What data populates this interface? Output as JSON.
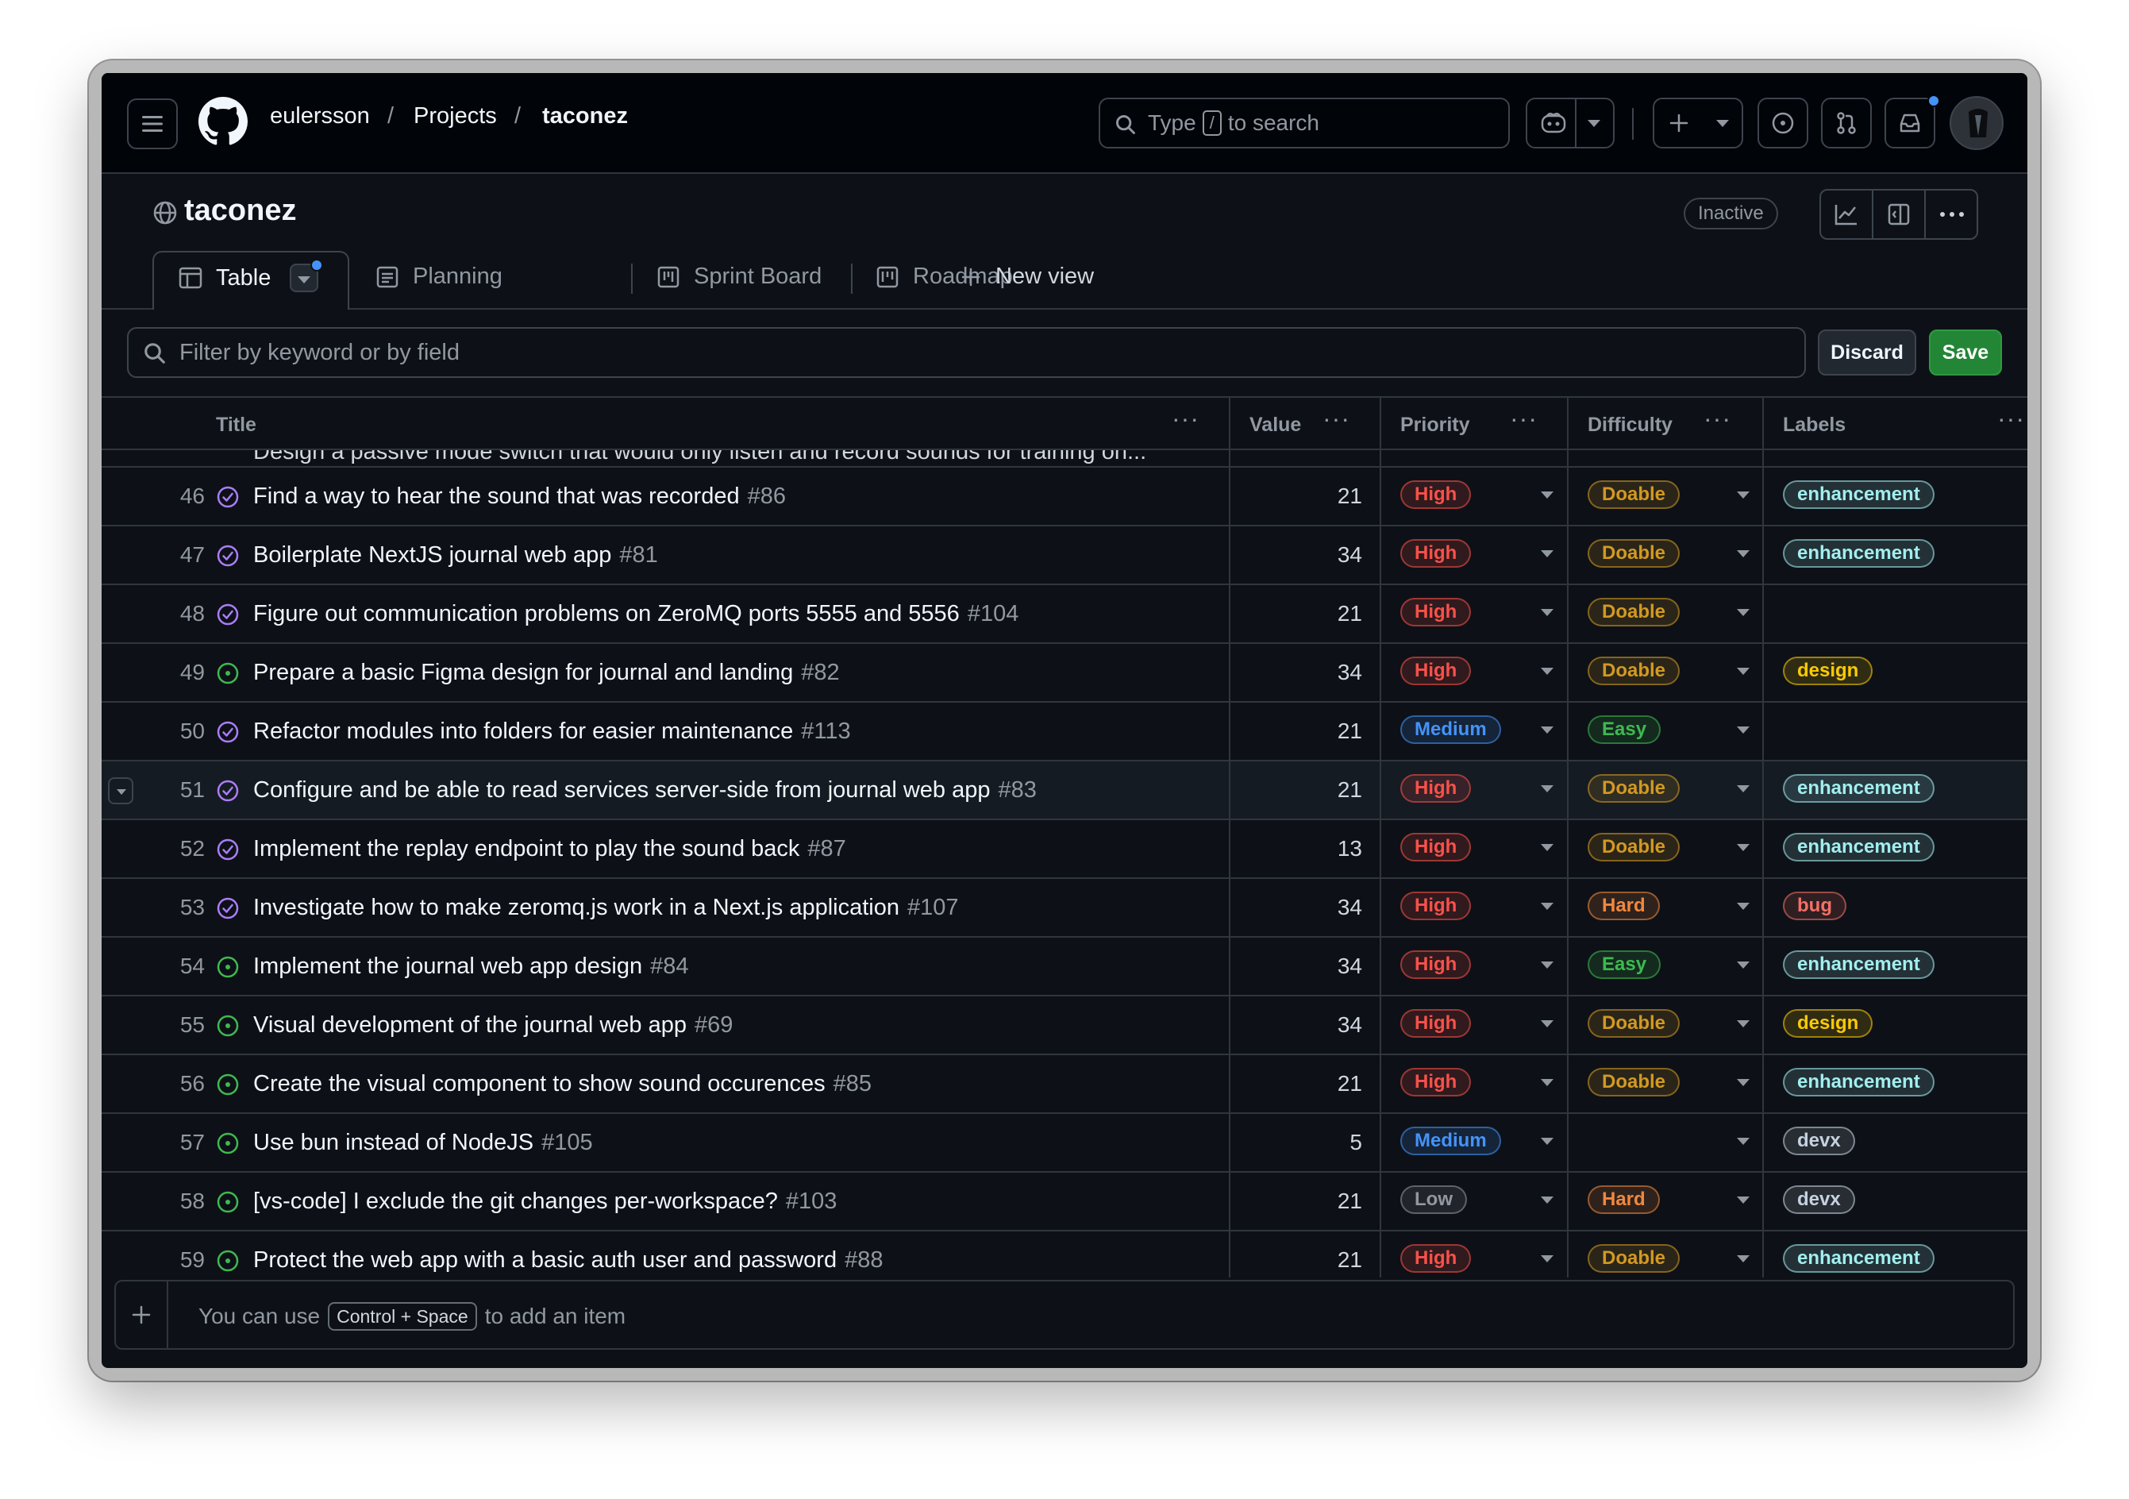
{
  "header": {
    "owner": "eulersson",
    "projects": "Projects",
    "repo": "taconez",
    "search_prefix": "Type",
    "search_key": "/",
    "search_suffix": "to search"
  },
  "project": {
    "title": "taconez",
    "status": "Inactive"
  },
  "tabs": [
    {
      "label": "Table"
    },
    {
      "label": "Planning"
    },
    {
      "label": "Sprint Board"
    },
    {
      "label": "Roadmap"
    },
    {
      "label": "New view"
    }
  ],
  "filter": {
    "placeholder": "Filter by keyword or by field",
    "discard_label": "Discard",
    "save_label": "Save"
  },
  "columns": {
    "title": "Title",
    "value": "Value",
    "priority": "Priority",
    "difficulty": "Difficulty",
    "labels": "Labels"
  },
  "partial_row": {
    "title": "Design a passive mode switch that would only listen and record sounds for training on..."
  },
  "rows": [
    {
      "num": "46",
      "state": "closed",
      "title": "Find a way to hear the sound that was recorded",
      "issue": "#86",
      "value": "21",
      "priority": "High",
      "difficulty": "Doable",
      "label": "enhancement"
    },
    {
      "num": "47",
      "state": "closed",
      "title": "Boilerplate NextJS journal web app",
      "issue": "#81",
      "value": "34",
      "priority": "High",
      "difficulty": "Doable",
      "label": "enhancement"
    },
    {
      "num": "48",
      "state": "closed",
      "title": "Figure out communication problems on ZeroMQ ports 5555 and 5556",
      "issue": "#104",
      "value": "21",
      "priority": "High",
      "difficulty": "Doable",
      "label": ""
    },
    {
      "num": "49",
      "state": "open",
      "title": "Prepare a basic Figma design for journal and landing",
      "issue": "#82",
      "value": "34",
      "priority": "High",
      "difficulty": "Doable",
      "label": "design"
    },
    {
      "num": "50",
      "state": "closed",
      "title": "Refactor modules into folders for easier maintenance",
      "issue": "#113",
      "value": "21",
      "priority": "Medium",
      "difficulty": "Easy",
      "label": ""
    },
    {
      "num": "51",
      "state": "closed",
      "title": "Configure and be able to read services server-side from journal web app",
      "issue": "#83",
      "value": "21",
      "priority": "High",
      "difficulty": "Doable",
      "label": "enhancement"
    },
    {
      "num": "52",
      "state": "closed",
      "title": "Implement the replay endpoint to play the sound back",
      "issue": "#87",
      "value": "13",
      "priority": "High",
      "difficulty": "Doable",
      "label": "enhancement"
    },
    {
      "num": "53",
      "state": "closed",
      "title": "Investigate how to make zeromq.js work in a Next.js application",
      "issue": "#107",
      "value": "34",
      "priority": "High",
      "difficulty": "Hard",
      "label": "bug"
    },
    {
      "num": "54",
      "state": "open",
      "title": "Implement the journal web app design",
      "issue": "#84",
      "value": "34",
      "priority": "High",
      "difficulty": "Easy",
      "label": "enhancement"
    },
    {
      "num": "55",
      "state": "open",
      "title": "Visual development of the journal web app",
      "issue": "#69",
      "value": "34",
      "priority": "High",
      "difficulty": "Doable",
      "label": "design"
    },
    {
      "num": "56",
      "state": "open",
      "title": "Create the visual component to show sound occurences",
      "issue": "#85",
      "value": "21",
      "priority": "High",
      "difficulty": "Doable",
      "label": "enhancement"
    },
    {
      "num": "57",
      "state": "open",
      "title": "Use bun instead of NodeJS",
      "issue": "#105",
      "value": "5",
      "priority": "Medium",
      "difficulty": "",
      "label": "devx"
    },
    {
      "num": "58",
      "state": "open",
      "title": "[vs-code] I exclude the git changes per-workspace?",
      "issue": "#103",
      "value": "21",
      "priority": "Low",
      "difficulty": "Hard",
      "label": "devx"
    },
    {
      "num": "59",
      "state": "open",
      "title": "Protect the web app with a basic auth user and password",
      "issue": "#88",
      "value": "21",
      "priority": "High",
      "difficulty": "Doable",
      "label": "enhancement"
    }
  ],
  "footer": {
    "prefix": "You can use",
    "shortcut": "Control + Space",
    "suffix": "to add an item"
  },
  "colors": {
    "closed_purple": "#ab7df8",
    "open_green": "#3fb950",
    "save_green": "#238636",
    "high": "#f85149",
    "medium": "#4493f8",
    "low": "#9198a1",
    "doable": "#d29922",
    "easy": "#3fb950",
    "hard": "#f0883e",
    "enhancement": "#a2eeef",
    "design": "#fbca04",
    "bug": "#f47067",
    "devx": "#c5d1e0"
  }
}
